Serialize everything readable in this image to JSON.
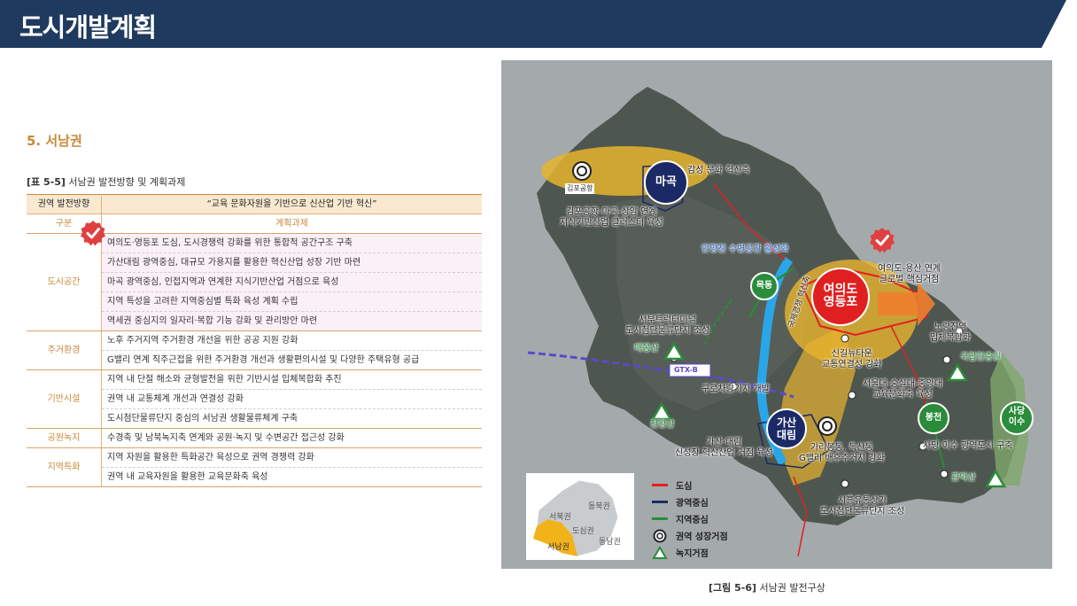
{
  "header": {
    "title": "도시개발계획"
  },
  "section": {
    "title": "5. 서남권"
  },
  "table": {
    "caption_num": "[표 5-5]",
    "caption_text": "서남권 발전방향 및 계획과제",
    "direction_label": "권역 발전방향",
    "direction_value": "“교육 문화자원을 기반으로 신산업 기반 혁신”",
    "col_category": "구분",
    "col_task": "계획과제",
    "groups": [
      {
        "category": "도시공간",
        "tasks": [
          "여의도·영등포 도심, 도시경쟁력 강화를 위한 통합적 공간구조 구축",
          "가산대림 광역중심, 대규모 가용지를 활용한 혁신산업 성장 기반 마련",
          "마곡 광역중심, 인접지역과 연계한 지식기반산업 거점으로 육성",
          "지역 특성을 고려한 지역중심별 특화 육성 계획 수립",
          "역세권 중심지의 일자리·복합 기능 강화 및 관리방안 마련"
        ]
      },
      {
        "category": "주거환경",
        "tasks": [
          "노후 주거지역 주거환경 개선을 위한 공공 지원 강화",
          "G밸리 연계 직주근접을 위한 주거환경 개선과 생활편의시설 및 다양한 주택유형 공급"
        ]
      },
      {
        "category": "기반시설",
        "tasks": [
          "지역 내 단절 해소와 균형발전을 위한 기반시설 입체복합화 추진",
          "권역 내 교통체계 개선과 연결성 강화",
          "도시첨단물류단지 중심의 서남권 생활물류체계 구축"
        ]
      },
      {
        "category": "공원녹지",
        "tasks": [
          "수경축 및 남북녹지축 연계와 공원·녹지 및 수변공간 접근성 강화"
        ]
      },
      {
        "category": "지역특화",
        "tasks": [
          "지역 자원을 활용한 특화공간 육성으로 권역 경쟁력 강화",
          "권역 내 교육자원을 활용한 교육문화축 육성"
        ]
      }
    ]
  },
  "map": {
    "circles": {
      "magok": "마곡",
      "yeouido": [
        "여의도",
        "영등포"
      ],
      "gasan": [
        "가산",
        "대림"
      ],
      "mokdong": "목동",
      "bongcheon": "봉천",
      "sadang": [
        "사당",
        "이수"
      ]
    },
    "labels": {
      "gimpo_airport": "김포공항",
      "gangseo_culture": "감성 문화 혁신축",
      "gimpo_link": [
        "김포공항-마곡-상암 연계",
        "지식기반산업 클러스터 육성"
      ],
      "anyang_river": "안양천 수변공간 활성화",
      "yeouido_link": [
        "여의도-용산 연계",
        "글로벌 핵심거점"
      ],
      "seobu_terminal": [
        "서부트럭터미널",
        "도시첨단물류단지 조성"
      ],
      "maebong": "매봉산",
      "gtxb": "GTX-B",
      "noryangjin": [
        "노량진역",
        "입체복합화"
      ],
      "singil": [
        "신길뉴타운",
        "교통연결성 강화"
      ],
      "national_cemetery": "국립현충원",
      "guro_depot": "구로차량기지 개발",
      "seoul_univ": [
        "서울대-숭실대-중앙대",
        "교육문화축 육성"
      ],
      "gukjegyeongjeong": "국제경쟁 혁신축",
      "cheonwang": "천왕산",
      "gasan_daerim": [
        "가산·대림",
        "신성장 혁신산업 거점 육성"
      ],
      "garibong": [
        "가리봉동, 독산동",
        "G밸리 배후주거지 강화"
      ],
      "sadang_link": "사당·이수 광역도시 구축",
      "gwanak": "관악산",
      "siheung": [
        "시흥유통상가",
        "도시첨단물류단지 조성"
      ]
    },
    "legend": [
      "도심",
      "광역중심",
      "지역중심",
      "권역 성장거점",
      "녹지거점"
    ],
    "inset": [
      "서북권",
      "동북권",
      "도심권",
      "동남권",
      "서남권"
    ]
  },
  "figure": {
    "caption_num": "[그림 5-6]",
    "caption_text": "서남권 발전구상"
  },
  "colors": {
    "header_bg": "#1f3a5f",
    "accent": "#c8893a",
    "center_red": "#e02020",
    "center_navy": "#1b2a66",
    "center_green": "#2a8c3a",
    "check_red": "#e04040"
  }
}
